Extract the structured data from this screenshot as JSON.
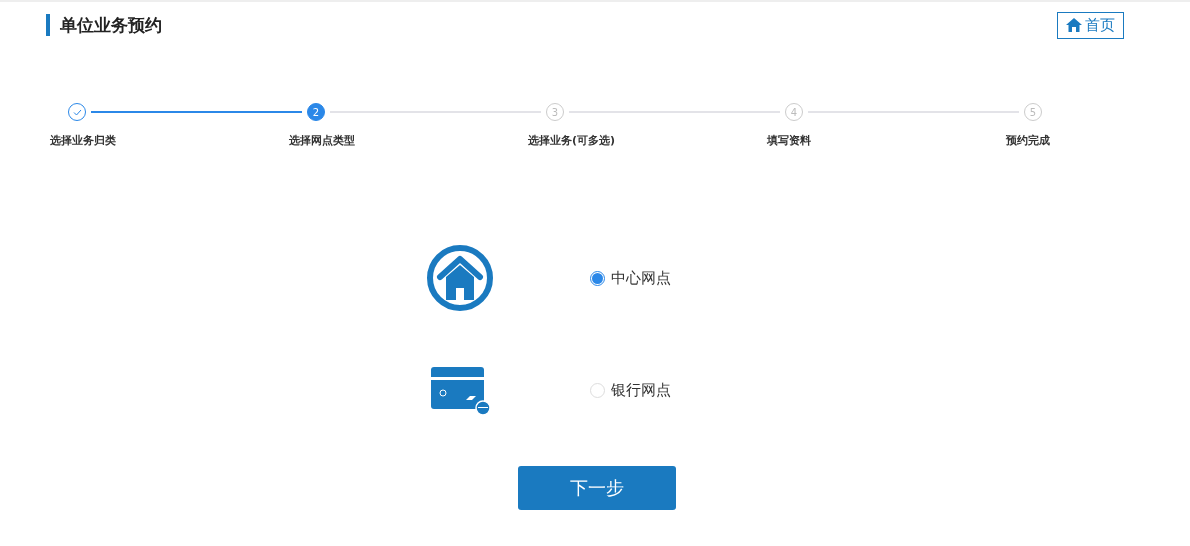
{
  "header": {
    "title": "单位业务预约",
    "home_button": "首页"
  },
  "steps": [
    {
      "label": "选择业务归类",
      "completed": true,
      "selected": false
    },
    {
      "label": "选择网点类型",
      "completed": false,
      "selected": true,
      "number": "2"
    },
    {
      "label": "选择业务(可多选)",
      "completed": false,
      "selected": false,
      "number": "3"
    },
    {
      "label": "填写资料",
      "completed": false,
      "selected": false,
      "number": "4"
    },
    {
      "label": "预约完成",
      "completed": false,
      "selected": false,
      "number": "5"
    }
  ],
  "options": [
    {
      "label": "中心网点",
      "kind": "house",
      "selected": true
    },
    {
      "label": "银行网点",
      "kind": "card",
      "selected": false
    }
  ],
  "next_button": "下一步"
}
